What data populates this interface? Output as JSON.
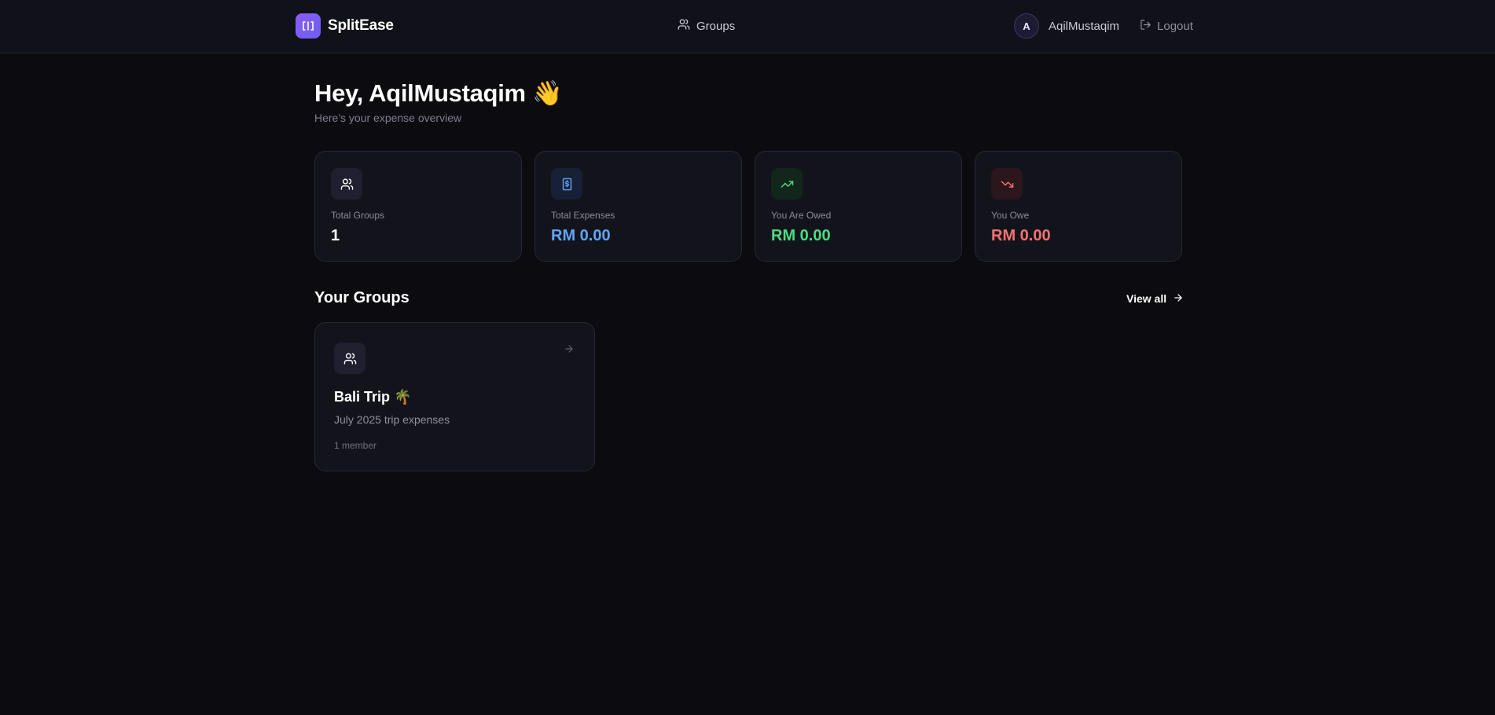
{
  "header": {
    "brand_name": "SplitEase",
    "nav_groups_label": "Groups",
    "avatar_initial": "A",
    "username": "AqilMustaqim",
    "logout_label": "Logout"
  },
  "greeting": {
    "title": "Hey, AqilMustaqim 👋",
    "subtitle": "Here's your expense overview"
  },
  "stats": [
    {
      "label": "Total Groups",
      "value": "1",
      "icon": "users-icon",
      "color": "#ffffff",
      "icon_bg": "#1f1f30"
    },
    {
      "label": "Total Expenses",
      "value": "RM 0.00",
      "icon": "dollar-receipt-icon",
      "color": "#60a5fa",
      "icon_bg": "#172036"
    },
    {
      "label": "You Are Owed",
      "value": "RM 0.00",
      "icon": "trending-up-icon",
      "color": "#4ade80",
      "icon_bg": "#13261c"
    },
    {
      "label": "You Owe",
      "value": "RM 0.00",
      "icon": "trending-down-icon",
      "color": "#f87171",
      "icon_bg": "#2a161b"
    }
  ],
  "groups_section": {
    "title": "Your Groups",
    "view_all_label": "View all",
    "groups": [
      {
        "name": "Bali Trip 🌴",
        "description": "July 2025 trip expenses",
        "members": "1 member"
      }
    ]
  },
  "colors": {
    "accent": "#7c5cf5",
    "background": "#0b0b10",
    "card": "#13141b"
  }
}
